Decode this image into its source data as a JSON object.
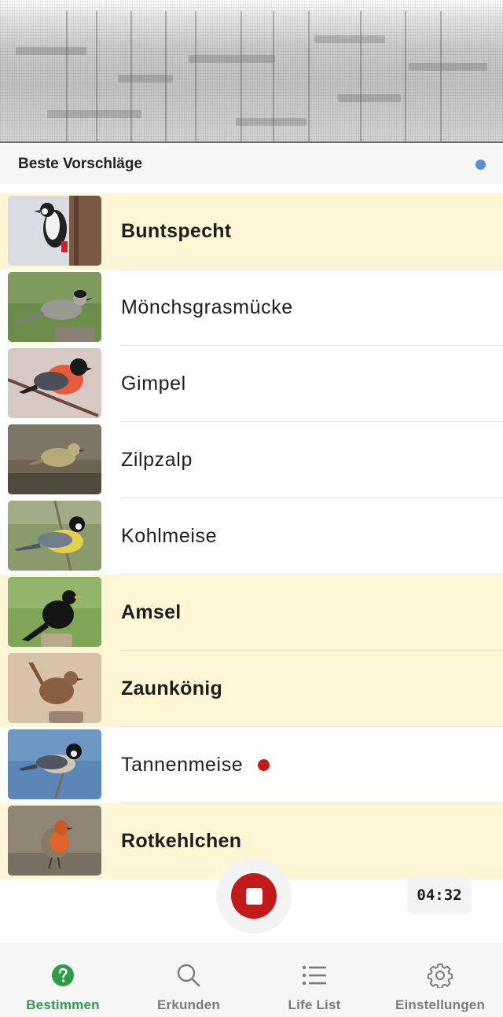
{
  "spectrogram": {
    "label": ""
  },
  "section": {
    "title": "Beste Vorschläge",
    "indicator_color": "#5b8fde"
  },
  "birds": [
    {
      "name": "Buntspecht",
      "highlighted": true,
      "new": false,
      "icon": "great-spotted-woodpecker-photo"
    },
    {
      "name": "Mönchsgrasmücke",
      "highlighted": false,
      "new": false,
      "icon": "blackcap-photo"
    },
    {
      "name": "Gimpel",
      "highlighted": false,
      "new": false,
      "icon": "bullfinch-photo"
    },
    {
      "name": "Zilpzalp",
      "highlighted": false,
      "new": false,
      "icon": "chiffchaff-photo"
    },
    {
      "name": "Kohlmeise",
      "highlighted": false,
      "new": false,
      "icon": "great-tit-photo"
    },
    {
      "name": "Amsel",
      "highlighted": true,
      "new": false,
      "icon": "blackbird-photo"
    },
    {
      "name": "Zaunkönig",
      "highlighted": true,
      "new": false,
      "icon": "wren-photo"
    },
    {
      "name": "Tannenmeise",
      "highlighted": false,
      "new": true,
      "icon": "coal-tit-photo"
    },
    {
      "name": "Rotkehlchen",
      "highlighted": true,
      "new": false,
      "icon": "robin-photo"
    }
  ],
  "recorder": {
    "timer": "04:32",
    "state": "recording",
    "button_color": "#c31b1b"
  },
  "nav": [
    {
      "label": "Bestimmen",
      "icon": "question-circle-icon",
      "active": true
    },
    {
      "label": "Erkunden",
      "icon": "search-icon",
      "active": false
    },
    {
      "label": "Life List",
      "icon": "list-icon",
      "active": false
    },
    {
      "label": "Einstellungen",
      "icon": "gear-icon",
      "active": false
    }
  ],
  "colors": {
    "highlight_row": "#fff6d6",
    "active_nav": "#2f9c4c",
    "new_dot": "#c11a1a"
  }
}
